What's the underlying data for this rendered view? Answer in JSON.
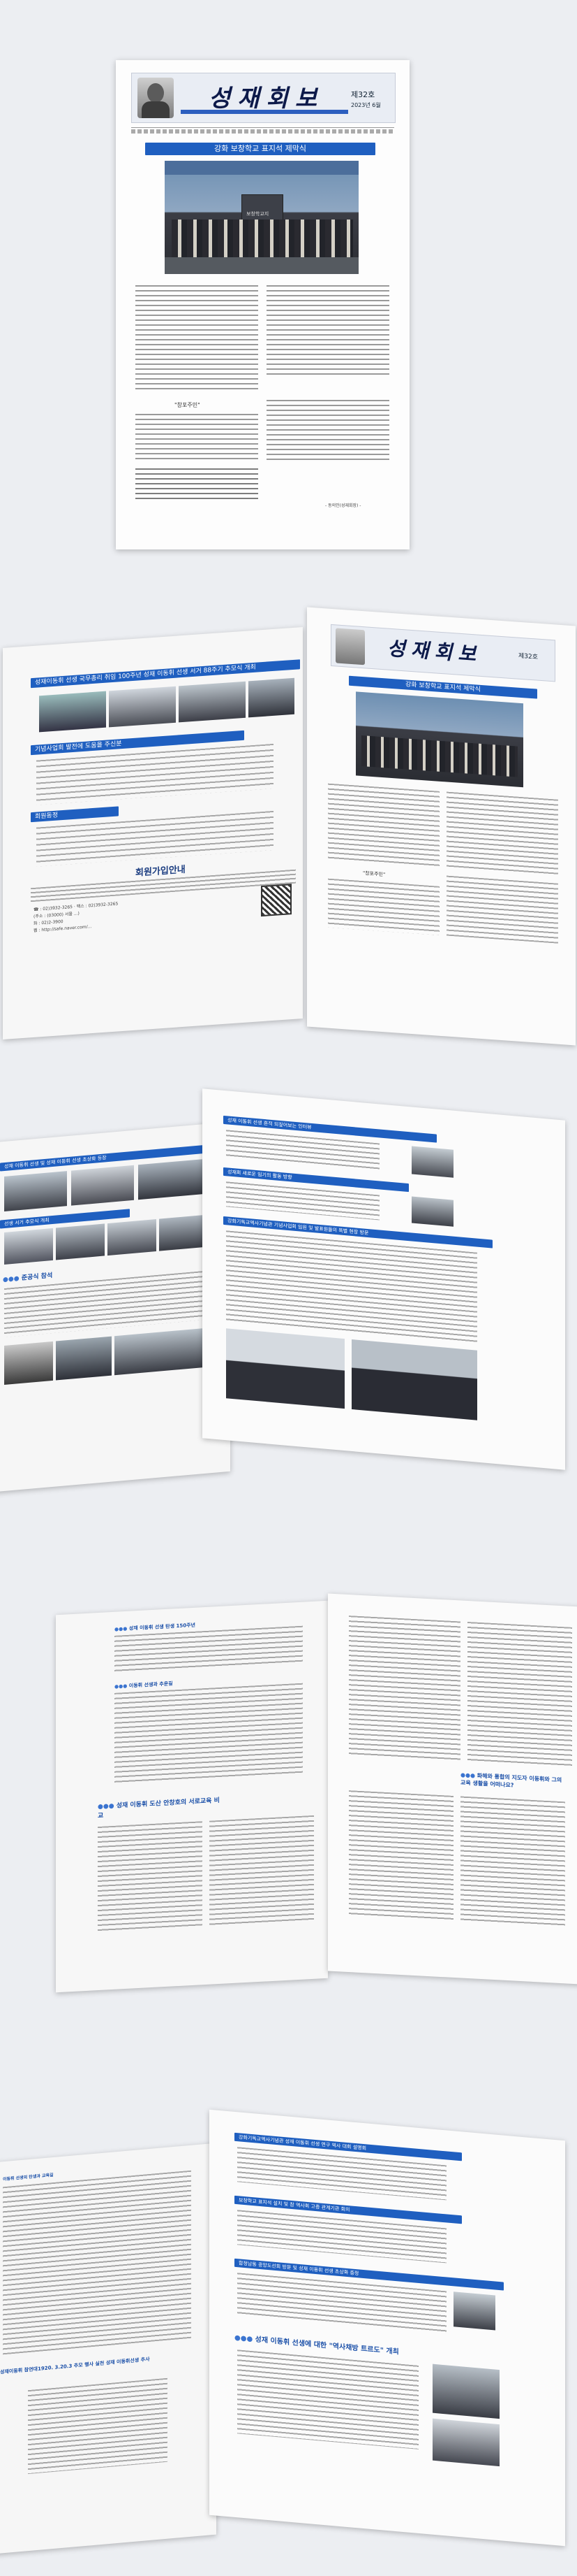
{
  "cover": {
    "masthead": "성재회보",
    "issue_no": "제32호",
    "issue_date": "2023년 6월",
    "headline": "강화 보창학교 표지석 제막식",
    "photo_sign": "보창학교지",
    "quote_heading": "\"창포주민\"",
    "byline": "- 동의인(성재회장) -"
  },
  "spread1": {
    "top_bar": "성재이동휘 선생 국무총리 취임 100주년 성재 이동휘 선생 서거 88주기 추모식 개최",
    "section_a": "기념사업회 발전에 도움을 주신분",
    "section_b": "회원동정",
    "notice_title": "회원가입안내",
    "notice_lines": [
      "☎ : 02)3932-3265 · 팩스 : 02)3932-3265",
      "(주소 : (03000) 서울 ...)",
      "화 : 02)2-3900",
      "웹 : http://safe.naver.com/..."
    ],
    "headline": "강화 보창학교 표지석 제막식",
    "masthead": "성재회보",
    "issue_no": "제32호",
    "quote_heading": "\"창포주민\""
  },
  "spread2": {
    "left_bar1": "성재 이동휘 선생 및 성재 이동휘 선생 초상화 등장",
    "left_bar2": "선생 서거 추모식 개최",
    "section_c": "준공식 참석",
    "right_bar1": "성재 이동휘 선생 흔적 되짚어보는 인터뷰",
    "right_bar2": "성재회 새로운 임기의 활동 방향",
    "right_bar3": "강화기독교역사기념관 기념사업회 임원 및 발표원들의 특별 현장 방문"
  },
  "spread3": {
    "left_title1": "성재 이동휘 선생 탄생 150주년",
    "left_title2": "이동휘 선생과 추운길",
    "left_title3": "성재 이동휘 도산 안창호의 서로교육 비교",
    "right_title": "화해와 통합의 지도자 이동휘와 그의 교육 생활을 어떠나요?"
  },
  "spread4": {
    "left_head": "이동휘 선생의 탄생과 교육길",
    "left_sub": "성재이동휘 참연대1920. 3.20.3 추모 행사 실천 성재 이동휘선생 추사",
    "right_bar1": "강화기독교역사기념관 성재 이동휘 선생 연구 역사 대회 설명회",
    "right_bar2": "보창학교 표지석 설치 및 참 역사회 고증 관계기관 회의",
    "right_bar3": "합정남동 중앙도선회 방문 및 성재 이동휘 선생 초상화 증정",
    "right_bar4": "성재 이동휘 선생에 대한 \"역사채방 트르도\" 개최"
  }
}
